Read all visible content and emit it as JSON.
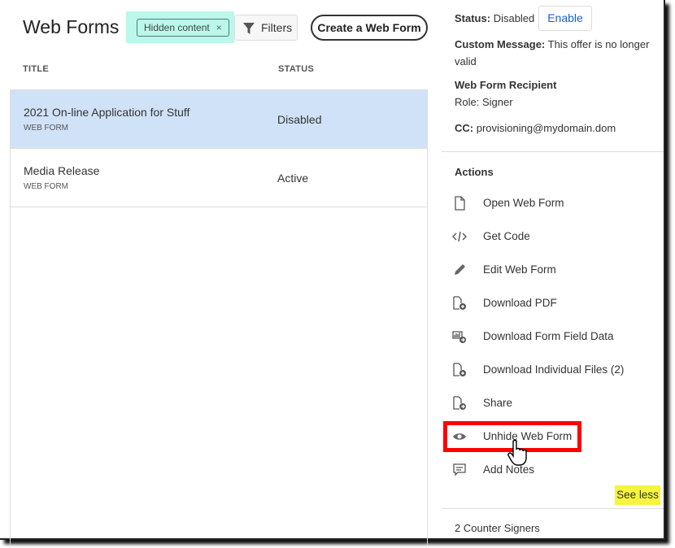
{
  "header": {
    "title": "Web Forms",
    "filter_chip": "Hidden content",
    "filter_chip_close": "×",
    "filters_label": "Filters",
    "create_label": "Create a Web Form"
  },
  "table": {
    "columns": [
      "TITLE",
      "STATUS"
    ],
    "rows": [
      {
        "title": "2021 On-line Application for Stuff",
        "type": "WEB FORM",
        "status": "Disabled",
        "selected": true
      },
      {
        "title": "Media Release",
        "type": "WEB FORM",
        "status": "Active",
        "selected": false
      }
    ]
  },
  "details": {
    "status_label": "Status:",
    "status_value": "Disabled",
    "enable_label": "Enable",
    "custom_message_label": "Custom Message:",
    "custom_message_value": "This offer is no longer valid",
    "recipient_heading": "Web Form Recipient",
    "role": "Role: Signer",
    "cc_label": "CC:",
    "cc_value": "provisioning@mydomain.dom"
  },
  "actions": {
    "heading": "Actions",
    "items": [
      {
        "label": "Open Web Form",
        "icon": "document-icon"
      },
      {
        "label": "Get Code",
        "icon": "code-icon"
      },
      {
        "label": "Edit Web Form",
        "icon": "pencil-icon"
      },
      {
        "label": "Download PDF",
        "icon": "pdf-download-icon"
      },
      {
        "label": "Download Form Field Data",
        "icon": "data-download-icon"
      },
      {
        "label": "Download Individual Files (2)",
        "icon": "file-download-icon"
      },
      {
        "label": "Share",
        "icon": "share-icon"
      },
      {
        "label": "Unhide Web Form",
        "icon": "eye-icon",
        "highlighted": true
      },
      {
        "label": "Add Notes",
        "icon": "notes-icon"
      }
    ],
    "see_less": "See less"
  },
  "counter_signers": "2 Counter Signers",
  "colors": {
    "selected_row": "#d0e2f8",
    "link": "#1a5fd6",
    "highlight_red": "#ff0000",
    "highlight_yellow": "#f6f43c",
    "highlight_teal": "#b9f8ea"
  }
}
